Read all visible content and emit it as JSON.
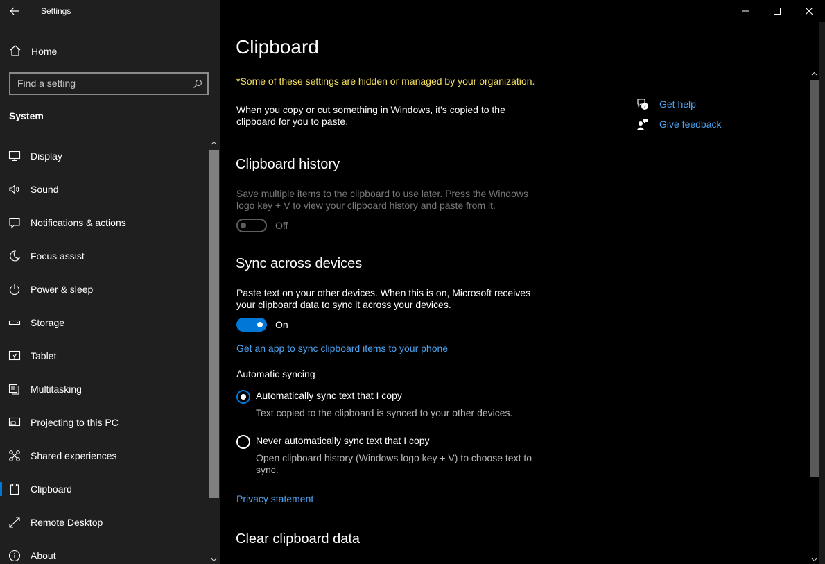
{
  "window": {
    "app_title": "Settings"
  },
  "sidebar": {
    "home_label": "Home",
    "search_placeholder": "Find a setting",
    "section_heading": "System",
    "items": [
      {
        "label": "Display",
        "icon": "monitor-icon"
      },
      {
        "label": "Sound",
        "icon": "speaker-icon"
      },
      {
        "label": "Notifications & actions",
        "icon": "notification-icon"
      },
      {
        "label": "Focus assist",
        "icon": "moon-icon"
      },
      {
        "label": "Power & sleep",
        "icon": "power-icon"
      },
      {
        "label": "Storage",
        "icon": "storage-icon"
      },
      {
        "label": "Tablet",
        "icon": "tablet-icon"
      },
      {
        "label": "Multitasking",
        "icon": "multitasking-icon"
      },
      {
        "label": "Projecting to this PC",
        "icon": "projecting-icon"
      },
      {
        "label": "Shared experiences",
        "icon": "shared-experiences-icon"
      },
      {
        "label": "Clipboard",
        "icon": "clipboard-icon",
        "selected": true
      },
      {
        "label": "Remote Desktop",
        "icon": "remote-desktop-icon"
      },
      {
        "label": "About",
        "icon": "info-icon"
      }
    ]
  },
  "main": {
    "title": "Clipboard",
    "org_note": "*Some of these settings are hidden or managed by your organization.",
    "intro": "When you copy or cut something in Windows, it's copied to the clipboard for you to paste.",
    "history": {
      "heading": "Clipboard history",
      "description": "Save multiple items to the clipboard to use later. Press the Windows logo key + V to view your clipboard history and paste from it.",
      "toggle_state": "Off"
    },
    "sync": {
      "heading": "Sync across devices",
      "description": "Paste text on your other devices. When this is on, Microsoft receives your clipboard data to sync it across your devices.",
      "toggle_state": "On",
      "app_link": "Get an app to sync clipboard items to your phone",
      "auto_heading": "Automatic syncing",
      "option_auto_label": "Automatically sync text that I copy",
      "option_auto_sub": "Text copied to the clipboard is synced to your other devices.",
      "option_never_label": "Never automatically sync text that I copy",
      "option_never_sub": "Open clipboard history (Windows logo key + V) to choose text to sync.",
      "privacy_link": "Privacy statement"
    },
    "clear_heading": "Clear clipboard data"
  },
  "help": {
    "get_help": "Get help",
    "give_feedback": "Give feedback"
  },
  "colors": {
    "accent": "#0078d7",
    "link": "#4ca3f0",
    "warning": "#f6e05e",
    "sidebar_bg": "#1f1f1f",
    "main_bg": "#000000"
  }
}
